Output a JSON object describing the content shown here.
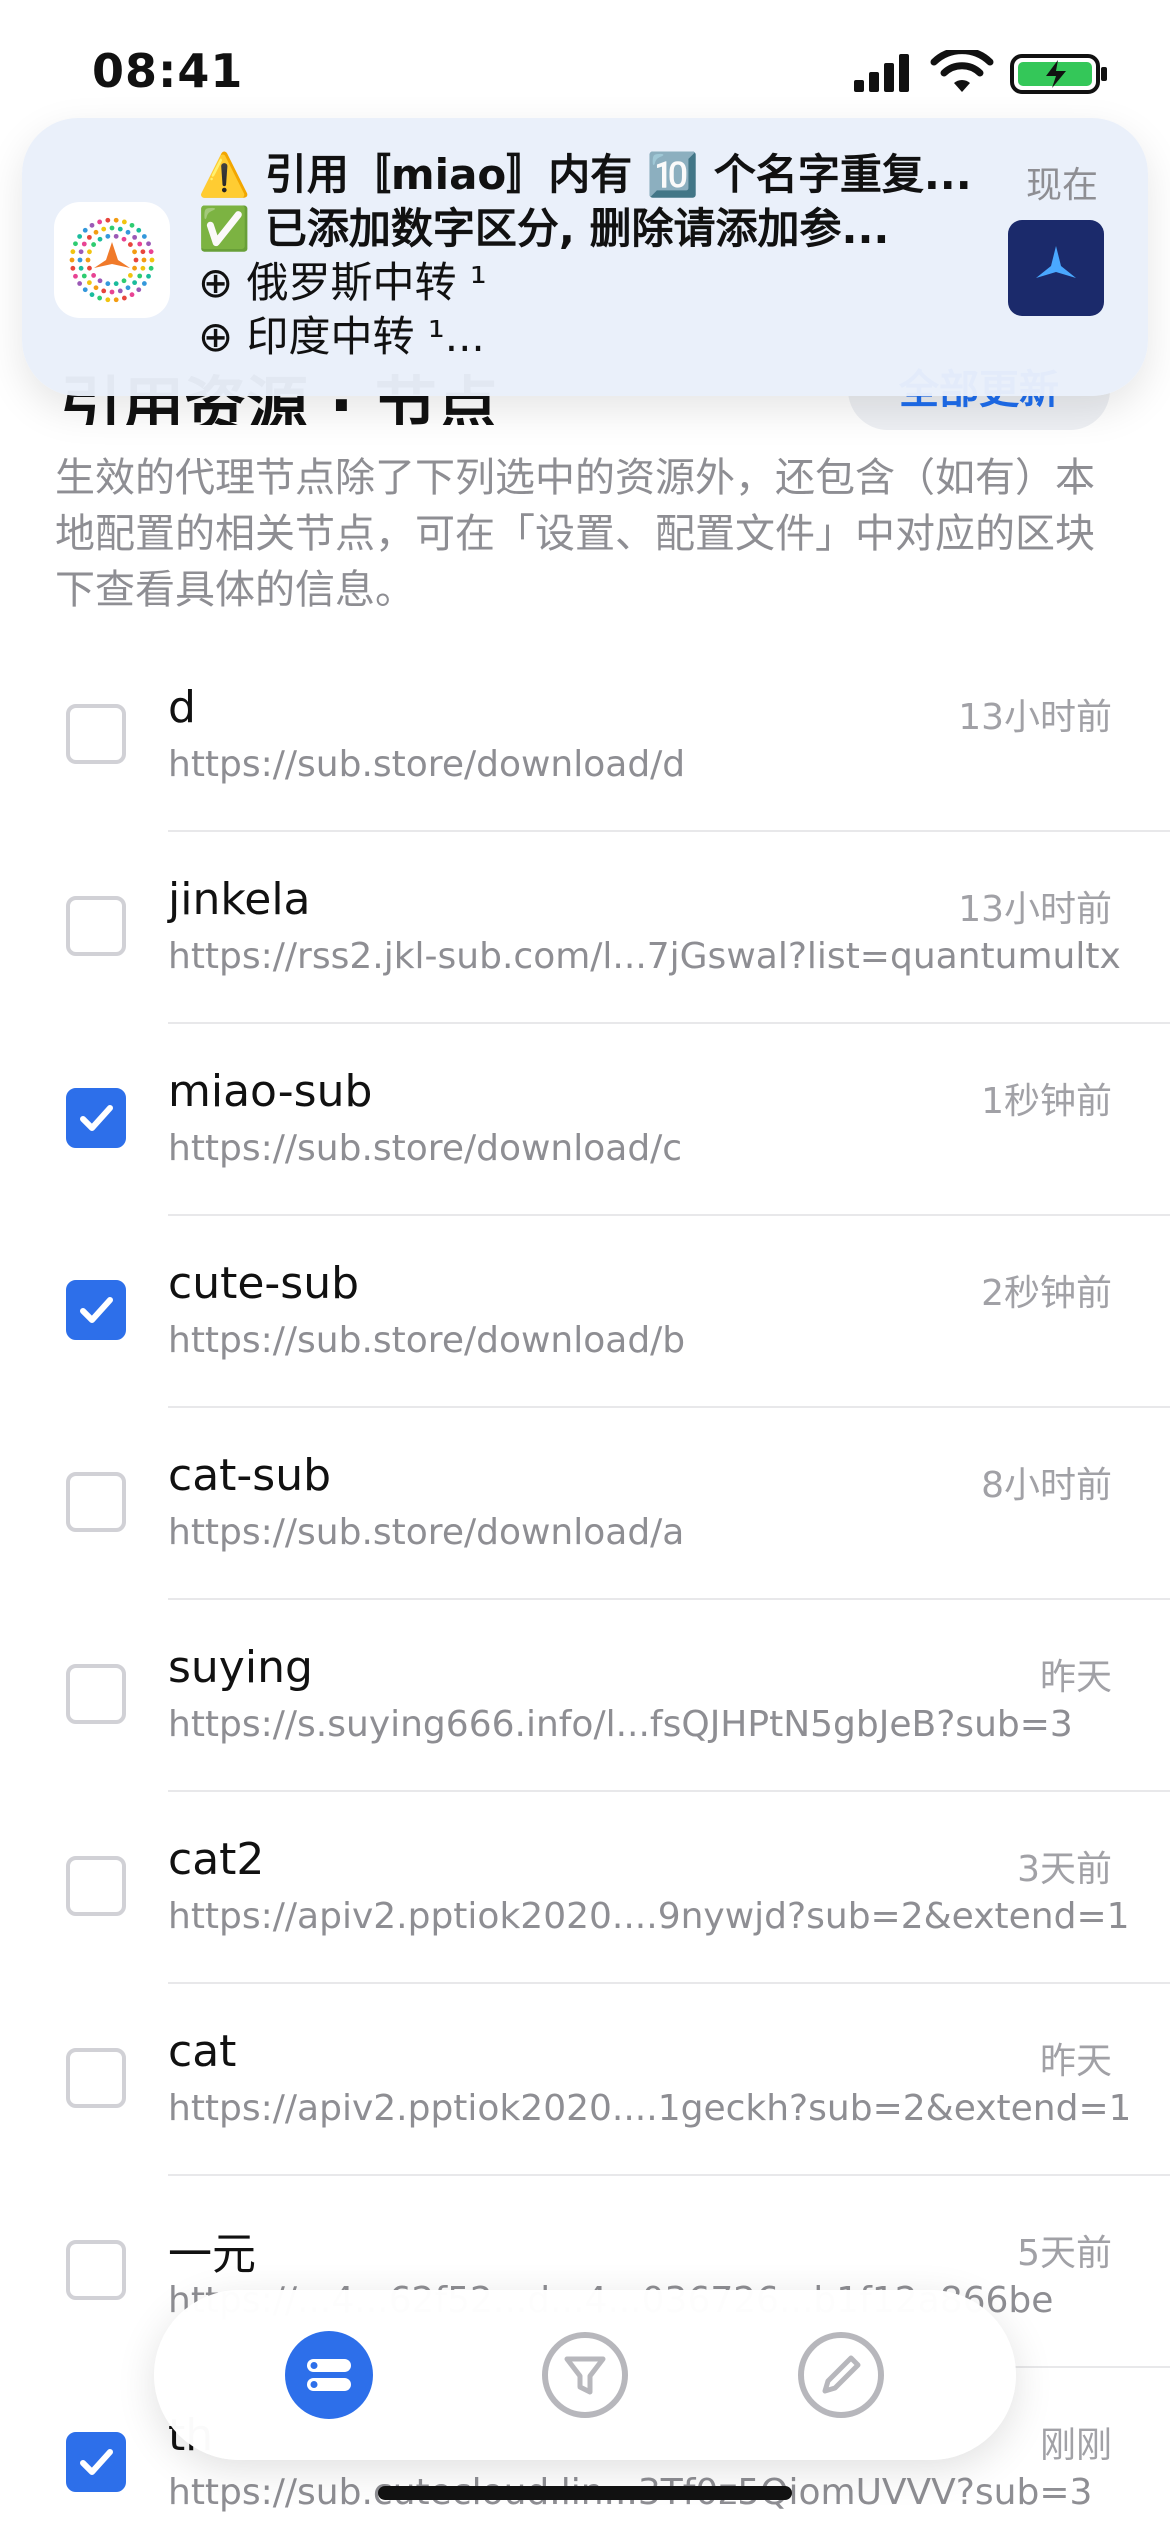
{
  "status_bar": {
    "time": "08:41"
  },
  "notification": {
    "lines": [
      "⚠️ 引用〚miao〛内有 🔟 个名字重复...",
      "✅ 已添加数字区分, 删除请添加参...",
      "⊕ 俄罗斯中转 ¹",
      "⊕ 印度中转 ¹..."
    ],
    "time": "现在"
  },
  "page": {
    "section_title": "引用资源 · 节点",
    "update_all_label": "全部更新",
    "description": "生效的代理节点除了下列选中的资源外，还包含（如有）本地配置的相关节点，可在「设置、配置文件」中对应的区块下查看具体的信息。"
  },
  "subscriptions": [
    {
      "name": "d",
      "url": "https://sub.store/download/d",
      "time": "13小时前",
      "checked": false
    },
    {
      "name": "jinkela",
      "url": "https://rss2.jkl-sub.com/l...7jGswal?list=quantumultx",
      "time": "13小时前",
      "checked": false
    },
    {
      "name": "miao-sub",
      "url": "https://sub.store/download/c",
      "time": "1秒钟前",
      "checked": true
    },
    {
      "name": "cute-sub",
      "url": "https://sub.store/download/b",
      "time": "2秒钟前",
      "checked": true
    },
    {
      "name": "cat-sub",
      "url": "https://sub.store/download/a",
      "time": "8小时前",
      "checked": false
    },
    {
      "name": "suying",
      "url": "https://s.suying666.info/l...fsQJHPtN5gbJeB?sub=3",
      "time": "昨天",
      "checked": false
    },
    {
      "name": "cat2",
      "url": "https://apiv2.pptiok2020....9nywjd?sub=2&extend=1",
      "time": "3天前",
      "checked": false
    },
    {
      "name": "cat",
      "url": "https://apiv2.pptiok2020....1geckh?sub=2&extend=1",
      "time": "昨天",
      "checked": false
    },
    {
      "name": "一元",
      "url": "https://...4...62f52...d...4...036726...b1f12a866be",
      "time": "5天前",
      "checked": false
    },
    {
      "name": "th",
      "url": "https://sub.cutecloud.lin...3Tf0z5QiomUVVV?sub=3",
      "time": "刚刚",
      "checked": true
    }
  ],
  "tab_bar": {
    "tabs": [
      {
        "icon": "subscriptions-icon",
        "active": true
      },
      {
        "icon": "filter-icon",
        "active": false
      },
      {
        "icon": "edit-icon",
        "active": false
      }
    ],
    "active_color": "#2d6fea",
    "inactive_color": "#b7b7bc"
  }
}
